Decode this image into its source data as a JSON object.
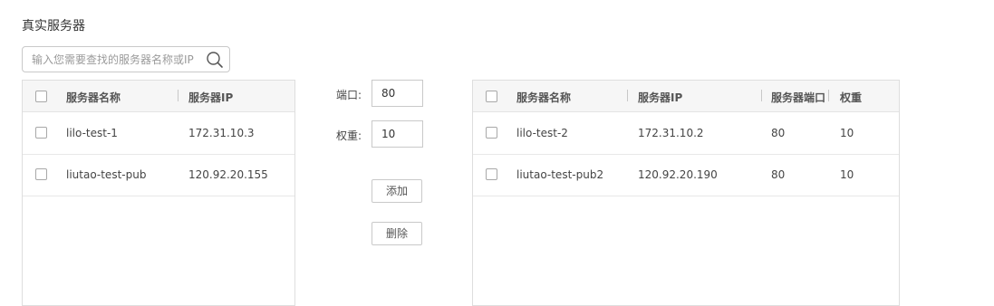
{
  "title": "真实服务器",
  "search": {
    "placeholder": "输入您需要查找的服务器名称或IP",
    "value": ""
  },
  "left_table": {
    "columns": [
      "服务器名称",
      "服务器IP"
    ],
    "rows": [
      {
        "name": "lilo-test-1",
        "ip": "172.31.10.3"
      },
      {
        "name": "liutao-test-pub",
        "ip": "120.92.20.155"
      }
    ]
  },
  "controls": {
    "port_label": "端口:",
    "port_value": "80",
    "weight_label": "权重:",
    "weight_value": "10",
    "add_label": "添加",
    "remove_label": "删除"
  },
  "right_table": {
    "columns": [
      "服务器名称",
      "服务器IP",
      "服务器端口",
      "权重"
    ],
    "rows": [
      {
        "name": "lilo-test-2",
        "ip": "172.31.10.2",
        "port": "80",
        "weight": "10"
      },
      {
        "name": "liutao-test-pub2",
        "ip": "120.92.20.190",
        "port": "80",
        "weight": "10"
      }
    ]
  }
}
